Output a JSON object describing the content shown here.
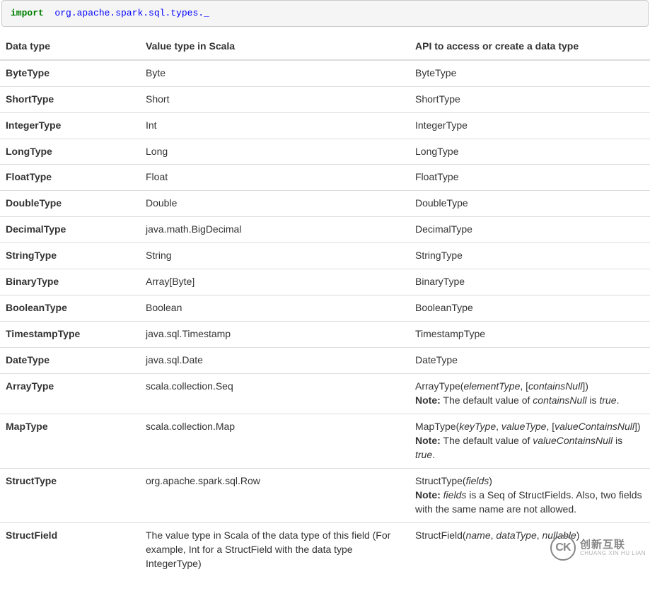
{
  "code": {
    "keyword": "import",
    "package": "org.apache.spark.sql.types._"
  },
  "table": {
    "headers": {
      "col0": "Data type",
      "col1": "Value type in Scala",
      "col2": "API to access or create a data type"
    },
    "rows": [
      {
        "type": "ByteType",
        "value": "Byte",
        "api_plain": "ByteType"
      },
      {
        "type": "ShortType",
        "value": "Short",
        "api_plain": "ShortType"
      },
      {
        "type": "IntegerType",
        "value": "Int",
        "api_plain": "IntegerType"
      },
      {
        "type": "LongType",
        "value": "Long",
        "api_plain": "LongType"
      },
      {
        "type": "FloatType",
        "value": "Float",
        "api_plain": "FloatType"
      },
      {
        "type": "DoubleType",
        "value": "Double",
        "api_plain": "DoubleType"
      },
      {
        "type": "DecimalType",
        "value": "java.math.BigDecimal",
        "api_plain": "DecimalType"
      },
      {
        "type": "StringType",
        "value": "String",
        "api_plain": "StringType"
      },
      {
        "type": "BinaryType",
        "value": "Array[Byte]",
        "api_plain": "BinaryType"
      },
      {
        "type": "BooleanType",
        "value": "Boolean",
        "api_plain": "BooleanType"
      },
      {
        "type": "TimestampType",
        "value": "java.sql.Timestamp",
        "api_plain": "TimestampType"
      },
      {
        "type": "DateType",
        "value": "java.sql.Date",
        "api_plain": "DateType"
      },
      {
        "type": "ArrayType",
        "value": "scala.collection.Seq",
        "api_rich": [
          {
            "t": "text",
            "v": "ArrayType("
          },
          {
            "t": "em",
            "v": "elementType"
          },
          {
            "t": "text",
            "v": ", ["
          },
          {
            "t": "em",
            "v": "containsNull"
          },
          {
            "t": "text",
            "v": "])"
          },
          {
            "t": "br"
          },
          {
            "t": "strong",
            "v": "Note:"
          },
          {
            "t": "text",
            "v": " The default value of "
          },
          {
            "t": "em",
            "v": "containsNull"
          },
          {
            "t": "text",
            "v": " is "
          },
          {
            "t": "em",
            "v": "true"
          },
          {
            "t": "text",
            "v": "."
          }
        ]
      },
      {
        "type": "MapType",
        "value": "scala.collection.Map",
        "api_rich": [
          {
            "t": "text",
            "v": "MapType("
          },
          {
            "t": "em",
            "v": "keyType"
          },
          {
            "t": "text",
            "v": ", "
          },
          {
            "t": "em",
            "v": "valueType"
          },
          {
            "t": "text",
            "v": ", ["
          },
          {
            "t": "em",
            "v": "valueContainsNull"
          },
          {
            "t": "text",
            "v": "])"
          },
          {
            "t": "br"
          },
          {
            "t": "strong",
            "v": "Note:"
          },
          {
            "t": "text",
            "v": " The default value of "
          },
          {
            "t": "em",
            "v": "valueContainsNull"
          },
          {
            "t": "text",
            "v": " is "
          },
          {
            "t": "em",
            "v": "true"
          },
          {
            "t": "text",
            "v": "."
          }
        ]
      },
      {
        "type": "StructType",
        "value": "org.apache.spark.sql.Row",
        "api_rich": [
          {
            "t": "text",
            "v": "StructType("
          },
          {
            "t": "em",
            "v": "fields"
          },
          {
            "t": "text",
            "v": ")"
          },
          {
            "t": "br"
          },
          {
            "t": "strong",
            "v": "Note:"
          },
          {
            "t": "text",
            "v": " "
          },
          {
            "t": "em",
            "v": "fields"
          },
          {
            "t": "text",
            "v": " is a Seq of StructFields. Also, two fields with the same name are not allowed."
          }
        ]
      },
      {
        "type": "StructField",
        "value": "The value type in Scala of the data type of this field (For example, Int for a StructField with the data type IntegerType)",
        "api_rich": [
          {
            "t": "text",
            "v": "StructField("
          },
          {
            "t": "em",
            "v": "name"
          },
          {
            "t": "text",
            "v": ", "
          },
          {
            "t": "em",
            "v": "dataType"
          },
          {
            "t": "text",
            "v": ", "
          },
          {
            "t": "em",
            "v": "nullable"
          },
          {
            "t": "text",
            "v": ")"
          }
        ]
      }
    ]
  },
  "watermark": {
    "logo_letters": "CK",
    "cn": "创新互联",
    "en": "CHUANG XIN HU LIAN"
  }
}
